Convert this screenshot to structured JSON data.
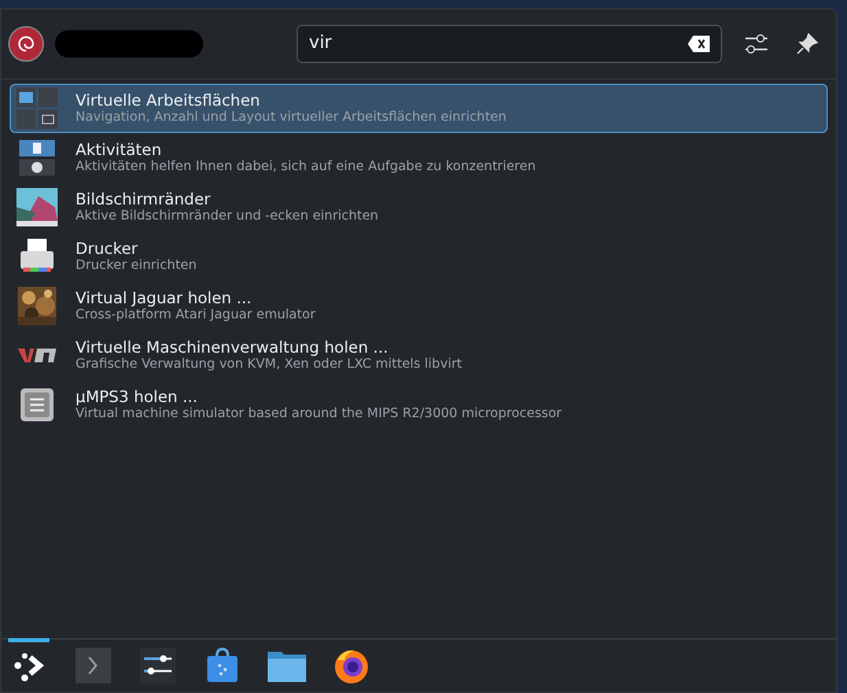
{
  "search": {
    "value": "vir"
  },
  "results": [
    {
      "kind": "workspaces",
      "title": "Virtuelle Arbeitsflächen",
      "subtitle": "Navigation, Anzahl und Layout virtueller Arbeitsflächen einrichten",
      "selected": true
    },
    {
      "kind": "activities",
      "title": "Aktivitäten",
      "subtitle": "Aktivitäten helfen Ihnen dabei, sich auf eine Aufgabe zu konzentrieren",
      "selected": false
    },
    {
      "kind": "edges",
      "title": "Bildschirmränder",
      "subtitle": "Aktive Bildschirmränder und -ecken einrichten",
      "selected": false
    },
    {
      "kind": "printer",
      "title": "Drucker",
      "subtitle": "Drucker einrichten",
      "selected": false
    },
    {
      "kind": "picture",
      "title": "Virtual Jaguar holen ...",
      "subtitle": "Cross-platform Atari Jaguar emulator",
      "selected": false
    },
    {
      "kind": "vm",
      "title": "Virtuelle Maschinenverwaltung holen ...",
      "subtitle": "Grafische Verwaltung von KVM, Xen oder LXC mittels libvirt",
      "selected": false
    },
    {
      "kind": "chip",
      "title": "µMPS3 holen ...",
      "subtitle": "Virtual machine simulator based around the MIPS R2/3000 microprocessor",
      "selected": false
    }
  ],
  "taskbar": [
    {
      "kind": "launcher",
      "selected": true
    },
    {
      "kind": "terminal",
      "selected": false
    },
    {
      "kind": "settings",
      "selected": false
    },
    {
      "kind": "store",
      "selected": false
    },
    {
      "kind": "folder",
      "selected": false
    },
    {
      "kind": "browser",
      "selected": false
    }
  ]
}
